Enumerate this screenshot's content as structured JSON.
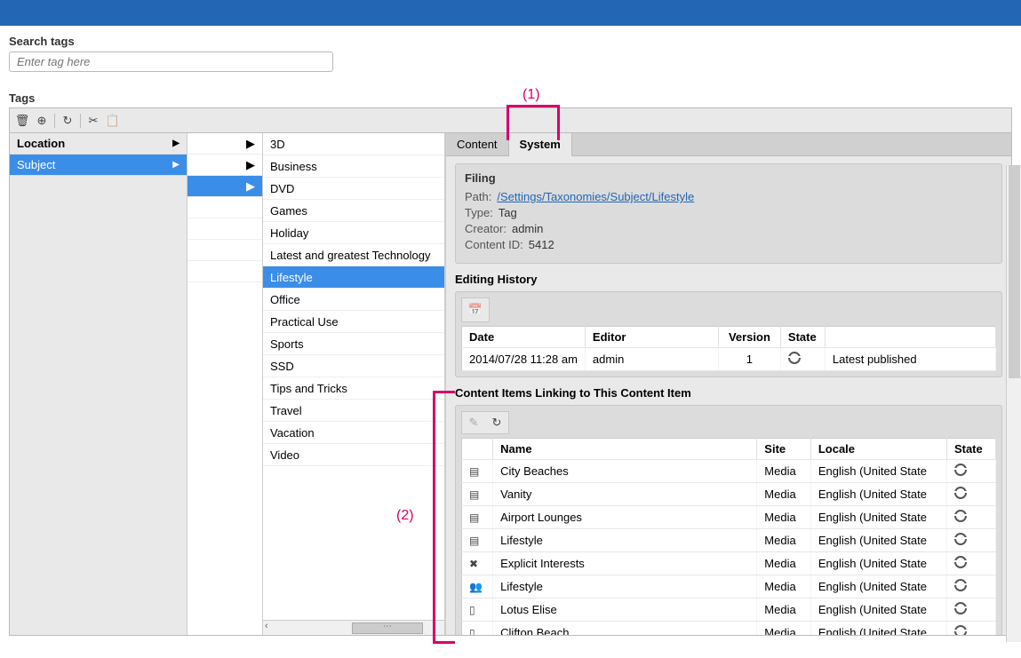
{
  "search": {
    "label": "Search tags",
    "placeholder": "Enter tag here"
  },
  "tags_label": "Tags",
  "categories": {
    "header": "Location",
    "selected": "Subject"
  },
  "mid2": {
    "items": [
      "3D",
      "Business",
      "DVD",
      "Games",
      "Holiday",
      "Latest and greatest Technology",
      "Lifestyle",
      "Office",
      "Practical Use",
      "Sports",
      "SSD",
      "Tips and Tricks",
      "Travel",
      "Vacation",
      "Video"
    ],
    "selected": "Lifestyle"
  },
  "tabs": {
    "content": "Content",
    "system": "System"
  },
  "filing": {
    "title": "Filing",
    "path_k": "Path:",
    "path_v": "/Settings/Taxonomies/Subject/Lifestyle",
    "type_k": "Type:",
    "type_v": "Tag",
    "creator_k": "Creator:",
    "creator_v": "admin",
    "cid_k": "Content ID:",
    "cid_v": "5412"
  },
  "history": {
    "title": "Editing History",
    "cols": {
      "date": "Date",
      "editor": "Editor",
      "version": "Version",
      "state": "State"
    },
    "rows": [
      {
        "date": "2014/07/28 11:28 am",
        "editor": "admin",
        "version": "1",
        "state": "Latest published"
      }
    ]
  },
  "linking": {
    "title": "Content Items Linking to This Content Item",
    "cols": {
      "name": "Name",
      "site": "Site",
      "locale": "Locale",
      "state": "State"
    },
    "rows": [
      {
        "icon": "layout",
        "name": "City Beaches",
        "site": "Media",
        "locale": "English (United State"
      },
      {
        "icon": "layout",
        "name": "Vanity",
        "site": "Media",
        "locale": "English (United State"
      },
      {
        "icon": "layout",
        "name": "Airport Lounges",
        "site": "Media",
        "locale": "English (United State"
      },
      {
        "icon": "layout",
        "name": "Lifestyle",
        "site": "Media",
        "locale": "English (United State"
      },
      {
        "icon": "tools",
        "name": "Explicit Interests",
        "site": "Media",
        "locale": "English (United State"
      },
      {
        "icon": "people",
        "name": "Lifestyle",
        "site": "Media",
        "locale": "English (United State"
      },
      {
        "icon": "doc",
        "name": "Lotus Elise",
        "site": "Media",
        "locale": "English (United State"
      },
      {
        "icon": "doc",
        "name": "Clifton Beach",
        "site": "Media",
        "locale": "English (United State"
      }
    ]
  },
  "annotations": {
    "one": "(1)",
    "two": "(2)"
  },
  "icons": {
    "layout": "▤",
    "tools": "✖",
    "people": "👥",
    "doc": "▯"
  }
}
